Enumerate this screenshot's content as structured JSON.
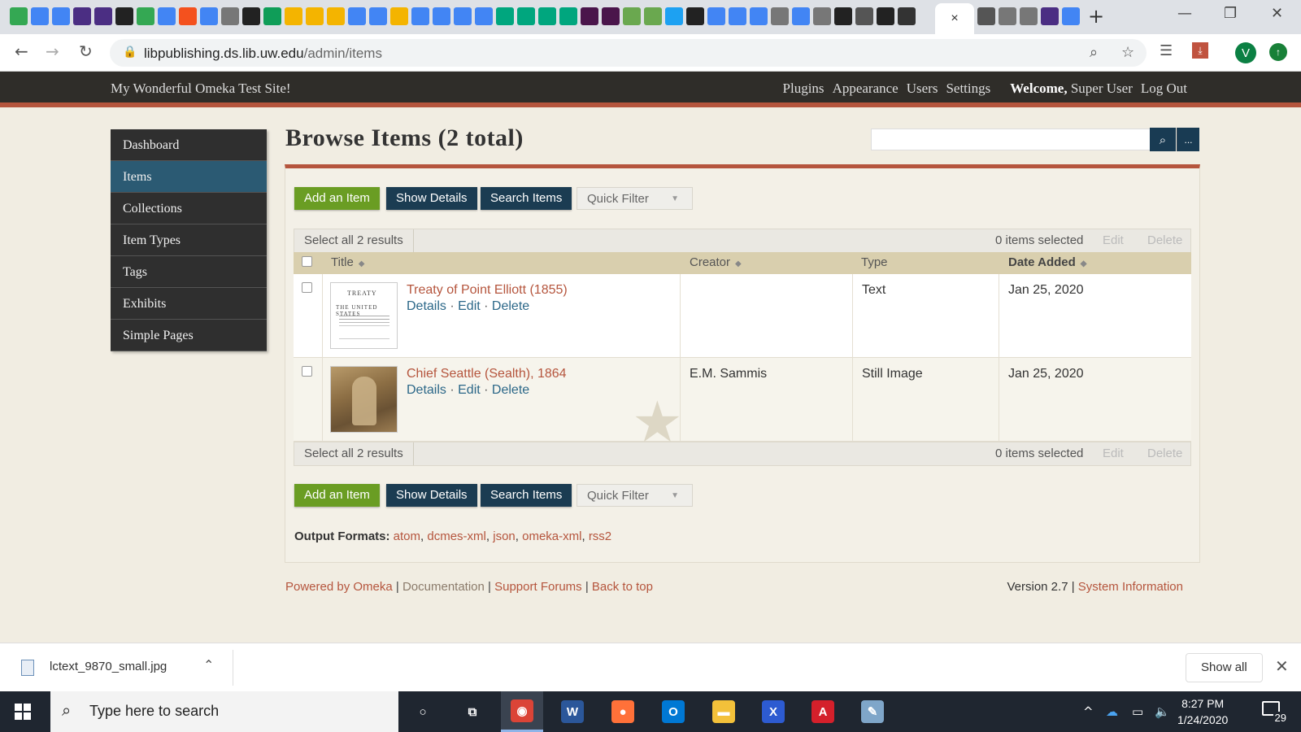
{
  "browser": {
    "active_tab_close": "×",
    "new_tab": "+",
    "window_controls": {
      "minimize": "—",
      "restore": "❐",
      "close": "✕"
    },
    "url_domain": "libpublishing.ds.lib.uw.edu",
    "url_path": "/admin/items",
    "back": "←",
    "forward": "→",
    "reload": "↻",
    "zoom_icon": "⌕",
    "bookmark_icon": "☆",
    "profile_initial": "V",
    "update_icon": "↑",
    "favicon_colors": [
      "#34a853",
      "#4285f4",
      "#4285f4",
      "#4b2e83",
      "#4b2e83",
      "#222",
      "#34a853",
      "#4285f4",
      "#f4511e",
      "#4285f4",
      "#777",
      "#222",
      "#0f9d58",
      "#f4b400",
      "#f4b400",
      "#f4b400",
      "#4285f4",
      "#4285f4",
      "#f4b400",
      "#4285f4",
      "#4285f4",
      "#4285f4",
      "#4285f4",
      "#00a67e",
      "#00a67e",
      "#00a67e",
      "#00a67e",
      "#4a154b",
      "#4a154b",
      "#6aa84f",
      "#6aa84f",
      "#1da1f2",
      "#222",
      "#4285f4",
      "#4285f4",
      "#4285f4",
      "#777",
      "#4285f4",
      "#777",
      "#222",
      "#555",
      "#222",
      "#333"
    ],
    "favicon_colors_right": [
      "#555",
      "#777",
      "#777",
      "#4b2e83",
      "#4285f4"
    ]
  },
  "omeka": {
    "site_title": "My Wonderful Omeka Test Site!",
    "nav": [
      "Plugins",
      "Appearance",
      "Users",
      "Settings"
    ],
    "welcome": "Welcome,",
    "user": "Super User",
    "logout": "Log Out",
    "sidebar": [
      {
        "label": "Dashboard",
        "active": false
      },
      {
        "label": "Items",
        "active": true
      },
      {
        "label": "Collections",
        "active": false
      },
      {
        "label": "Item Types",
        "active": false
      },
      {
        "label": "Tags",
        "active": false
      },
      {
        "label": "Exhibits",
        "active": false
      },
      {
        "label": "Simple Pages",
        "active": false
      }
    ],
    "page_title": "Browse Items (2 total)",
    "search_icon": "search-icon",
    "advanced_search_label": "...",
    "buttons": {
      "add_item": "Add an Item",
      "show_details": "Show Details",
      "search_items": "Search Items",
      "quick_filter": "Quick Filter"
    },
    "batch": {
      "select_all": "Select all 2 results",
      "selected_count": "0 items selected",
      "edit": "Edit",
      "delete": "Delete"
    },
    "columns": [
      "Title",
      "Creator",
      "Type",
      "Date Added"
    ],
    "items": [
      {
        "title": "Treaty of Point Elliott (1855)",
        "details": "Details",
        "edit": "Edit",
        "delete": "Delete",
        "creator": "",
        "type": "Text",
        "date_added": "Jan 25, 2020",
        "thumb_text_1": "TREATY",
        "thumb_text_2": "THE UNITED STATES"
      },
      {
        "title": "Chief Seattle (Sealth), 1864",
        "details": "Details",
        "edit": "Edit",
        "delete": "Delete",
        "creator": "E.M. Sammis",
        "type": "Still Image",
        "date_added": "Jan 25, 2020",
        "featured": true
      }
    ],
    "separator": " · ",
    "output_formats_label": "Output Formats:",
    "output_formats": [
      "atom",
      "dcmes-xml",
      "json",
      "omeka-xml",
      "rss2"
    ],
    "footer": {
      "powered_by": "Powered by Omeka",
      "documentation": "Documentation",
      "support_forums": "Support Forums",
      "back_to_top": "Back to top",
      "version": "Version 2.7",
      "system_info": "System Information"
    }
  },
  "download_bar": {
    "filename": "lctext_9870_small.jpg",
    "show_all": "Show all",
    "close": "✕"
  },
  "taskbar": {
    "search_placeholder": "Type here to search",
    "time": "8:27 PM",
    "date": "1/24/2020",
    "notification_count": "29",
    "apps": [
      {
        "name": "cortana",
        "glyph": "○",
        "color": "transparent"
      },
      {
        "name": "task-view",
        "glyph": "⧉",
        "color": "transparent"
      },
      {
        "name": "chrome",
        "glyph": "◉",
        "color": "#db4437",
        "active": true
      },
      {
        "name": "word",
        "glyph": "W",
        "color": "#2b579a"
      },
      {
        "name": "firefox",
        "glyph": "●",
        "color": "#ff7139"
      },
      {
        "name": "outlook",
        "glyph": "O",
        "color": "#0078d4"
      },
      {
        "name": "file-explorer",
        "glyph": "▬",
        "color": "#f3c13a"
      },
      {
        "name": "xmind",
        "glyph": "X",
        "color": "#2d5bd1"
      },
      {
        "name": "acrobat",
        "glyph": "A",
        "color": "#d4202b"
      },
      {
        "name": "paint",
        "glyph": "✎",
        "color": "#7fa6c9"
      }
    ],
    "tray": {
      "chevron": "^",
      "cloud": "☁",
      "battery": "▭",
      "volume": "🔈"
    }
  }
}
